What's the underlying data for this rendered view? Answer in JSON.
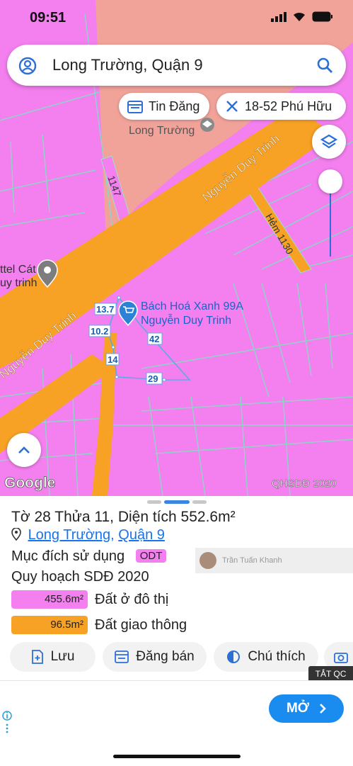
{
  "status_bar": {
    "time": "09:51"
  },
  "search": {
    "query": "Long Trường, Quận 9"
  },
  "chips": {
    "listing": "Tin Đăng",
    "location": "18-52 Phú Hữu"
  },
  "map": {
    "labels": {
      "road_main_a": "Nguyễn Duy Trinh",
      "road_main_b": "Nguyễn Duy Trinh",
      "road_1147": "1147",
      "road_hem": "Hẻm 1130",
      "poi_top": "Long Trường",
      "poi_left_1": "ttel Cát",
      "poi_left_2": "uy trinh",
      "poi_store_1": "Bách Hoá Xanh 99A",
      "poi_store_2": "Nguyễn Duy Trinh",
      "google": "Google",
      "plan_tag": "QHSDĐ 2020"
    },
    "dimensions": [
      "13.7",
      "10.2",
      "14",
      "42",
      "29"
    ],
    "colors": {
      "residential": "#f47fef",
      "transport": "#f7a125",
      "park": "#f1a39a",
      "boundary": "#5ea8e6"
    }
  },
  "sheet": {
    "parcel_prefix_to": "Tờ ",
    "parcel_sheet": "28",
    "parcel_prefix_thua": " Thửa ",
    "parcel_lot": "11",
    "parcel_area_label": ", Diện tích ",
    "parcel_area": "552.6m²",
    "ward_link": "Long Trường",
    "district_link": "Quận 9",
    "purpose_label": "Mục đích sử dụng",
    "purpose_code": "ODT",
    "plan_label": "Quy hoạch SDĐ 2020",
    "land_uses": [
      {
        "area": "455.6m²",
        "label": "Đất ở đô thị",
        "color": "#f47fef"
      },
      {
        "area": "96.5m²",
        "label": "Đất giao thông",
        "color": "#f7a125"
      }
    ],
    "actions": {
      "save": "Lưu",
      "post": "Đăng bán",
      "legend": "Chú thích"
    },
    "watermark": "Trần Tuấn Khanh"
  },
  "ad": {
    "hide": "TẮT QC",
    "open": "MỞ"
  }
}
